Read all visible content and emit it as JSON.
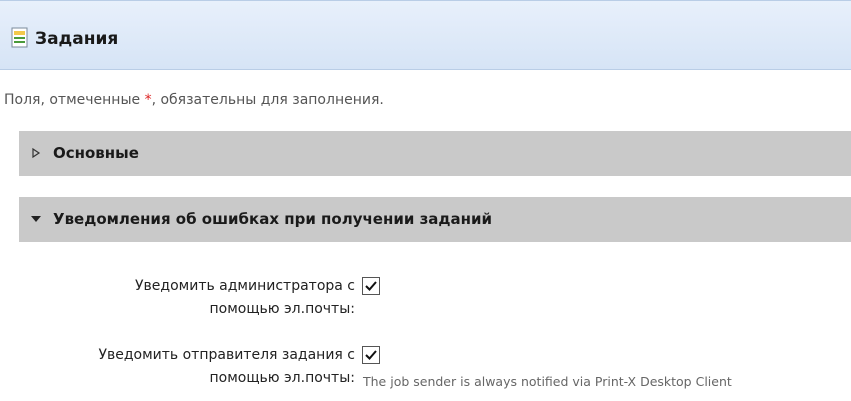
{
  "header": {
    "title": "Задания",
    "icon": "document-icon"
  },
  "required_note": {
    "before": "Поля, отмеченные ",
    "star": "*",
    "after": ", обязательны для заполнения."
  },
  "sections": [
    {
      "label": "Основные",
      "expanded": false,
      "icon": "triangle-right-outline-icon"
    },
    {
      "label": "Уведомления об ошибках при получении заданий",
      "expanded": true,
      "icon": "triangle-down-icon"
    }
  ],
  "fields": [
    {
      "label_line1": "Уведомить администратора с",
      "label_line2": "помощью эл.почты:",
      "checked": true
    },
    {
      "label_line1": "Уведомить отправителя задания с",
      "label_line2": "помощью эл.почты:",
      "checked": true,
      "hint": "The job sender is always notified via Print-X Desktop Client"
    }
  ],
  "colors": {
    "header_bg": "#d6e4f6",
    "section_bg": "#c9c9c9",
    "required_star": "#dd2222"
  }
}
